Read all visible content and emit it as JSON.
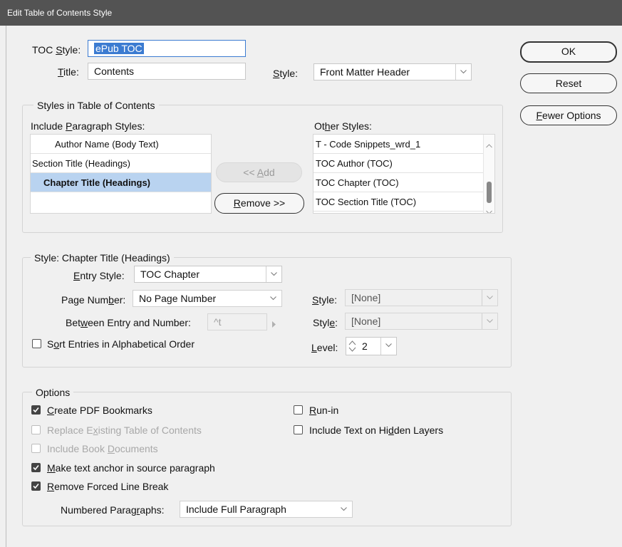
{
  "window": {
    "title": "Edit Table of Contents Style"
  },
  "toc_style": {
    "label_pre": "TOC ",
    "label_u": "S",
    "label_post": "tyle:",
    "value": "ePub TOC"
  },
  "title_field": {
    "label_pre": "",
    "label_u": "T",
    "label_post": "itle:",
    "value": "Contents"
  },
  "title_style": {
    "label_pre": "",
    "label_u": "S",
    "label_post": "tyle:",
    "value": "Front Matter Header"
  },
  "buttons": {
    "ok": "OK",
    "reset": "Reset",
    "fewer_pre": "",
    "fewer_u": "F",
    "fewer_post": "ewer Options"
  },
  "styles_group": {
    "title": "Styles in Table of Contents",
    "include_label_pre": "Include ",
    "include_label_u": "P",
    "include_label_post": "aragraph Styles:",
    "other_label_pre": "Ot",
    "other_label_u": "h",
    "other_label_post": "er Styles:",
    "include_items": [
      "Author Name (Body Text)",
      "Section Title (Headings)",
      "Chapter Title (Headings)"
    ],
    "other_items": [
      "T - Code Snippets_wrd_1",
      "TOC Author (TOC)",
      "TOC Chapter (TOC)",
      "TOC Section Title (TOC)"
    ],
    "add_pre": "<< ",
    "add_u": "A",
    "add_post": "dd",
    "remove_pre": "",
    "remove_u": "R",
    "remove_post": "emove >>"
  },
  "entry_group": {
    "title": "Style: Chapter Title (Headings)",
    "entry_style_label_pre": "",
    "entry_style_label_u": "E",
    "entry_style_label_post": "ntry Style:",
    "entry_style_value": "TOC Chapter",
    "page_number_label_pre": "Page Num",
    "page_number_label_u": "b",
    "page_number_label_post": "er:",
    "page_number_value": "No Page Number",
    "between_label_pre": "Bet",
    "between_label_u": "w",
    "between_label_post": "een Entry and Number:",
    "between_value": "^t",
    "style1_label_pre": "",
    "style1_label_u": "S",
    "style1_label_post": "tyle:",
    "style1_value": "[None]",
    "style2_label_pre": "Styl",
    "style2_label_u": "e",
    "style2_label_post": ":",
    "style2_value": "[None]",
    "sort_label_pre": "S",
    "sort_label_u": "o",
    "sort_label_post": "rt Entries in Alphabetical Order",
    "level_label_pre": "",
    "level_label_u": "L",
    "level_label_post": "evel:",
    "level_value": "2"
  },
  "options_group": {
    "title": "Options",
    "create_pdf_pre": "",
    "create_pdf_u": "C",
    "create_pdf_post": "reate PDF Bookmarks",
    "replace_pre": "Replace E",
    "replace_u": "x",
    "replace_post": "isting Table of Contents",
    "include_book_pre": "Include Book ",
    "include_book_u": "D",
    "include_book_post": "ocuments",
    "make_anchor_pre": "",
    "make_anchor_u": "M",
    "make_anchor_post": "ake text anchor in source paragraph",
    "remove_break_pre": "",
    "remove_break_u": "R",
    "remove_break_post": "emove Forced Line Break",
    "run_in_pre": "",
    "run_in_u": "R",
    "run_in_post": "un-in",
    "hidden_pre": "Include Text on Hi",
    "hidden_u": "d",
    "hidden_post": "den Layers",
    "numbered_label_pre": "Numbered Parag",
    "numbered_label_u": "r",
    "numbered_label_post": "aphs:",
    "numbered_value": "Include Full Paragraph"
  },
  "checks": {
    "create_pdf": true,
    "replace": false,
    "include_book": false,
    "make_anchor": true,
    "remove_break": true,
    "run_in": false,
    "hidden_layers": false,
    "sort": false
  },
  "colors": {
    "titlebar": "#535353",
    "selection": "#3b7bd1",
    "list_selected": "#b9d3f0"
  }
}
